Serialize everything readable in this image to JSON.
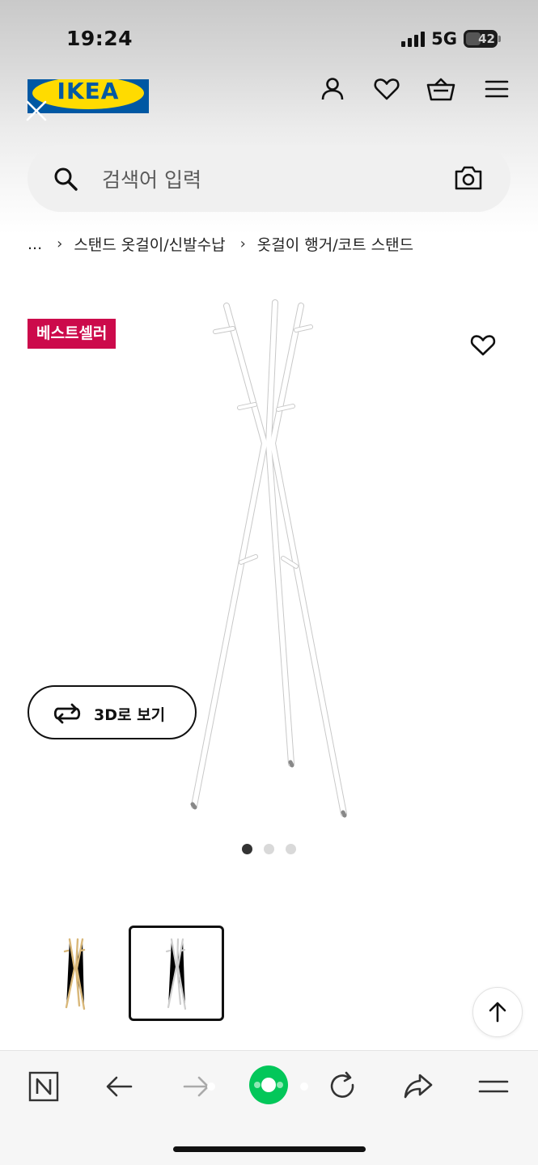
{
  "status_bar": {
    "time": "19:24",
    "network": "5G",
    "battery": "42"
  },
  "header": {
    "logo_text": "IKEA"
  },
  "search": {
    "placeholder": "검색어 입력"
  },
  "breadcrumb": {
    "ellipsis": "...",
    "items": [
      "스탠드 옷걸이/신발수납",
      "옷걸이 행거/코트 스탠드"
    ],
    "separator": "›"
  },
  "product": {
    "badge": "베스트셀러",
    "view_3d_label": "3D로 보기"
  },
  "carousel": {
    "total": 3,
    "active": 1
  },
  "colors": {
    "ikea_blue": "#0058a3",
    "ikea_yellow": "#ffdb00",
    "badge_red": "#cc0a4b",
    "naver_green": "#03c75a"
  },
  "icons": [
    "close-icon",
    "user-icon",
    "heart-icon",
    "cart-icon",
    "menu-icon",
    "search-icon",
    "camera-icon",
    "rotate-3d-icon",
    "arrow-up-icon",
    "naver-icon",
    "back-icon",
    "forward-icon",
    "reload-icon",
    "share-icon"
  ]
}
